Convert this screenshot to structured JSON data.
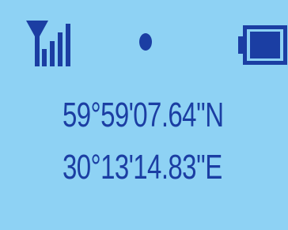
{
  "status_bar": {
    "signal": {
      "icon": "signal-strength-icon"
    },
    "indicator": {
      "icon": "dot-indicator-icon"
    },
    "battery": {
      "icon": "battery-icon"
    }
  },
  "coordinates": {
    "latitude": "59°59'07.64''N",
    "longitude": "30°13'14.83''E"
  },
  "colors": {
    "background": "#8ed2f4",
    "foreground": "#1b3ea3"
  }
}
